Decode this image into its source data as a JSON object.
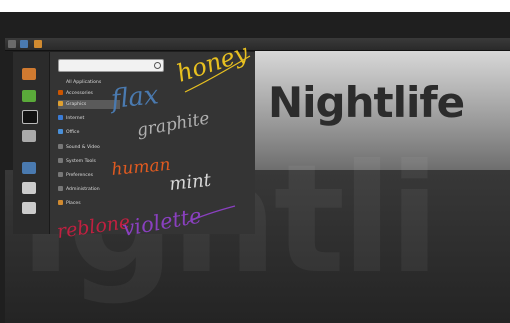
{
  "wallpaper": {
    "heading": "Nightlife",
    "big_text": "ightli"
  },
  "menu": {
    "search_placeholder": "",
    "categories": [
      {
        "label": "All Applications",
        "icon": "all-apps-icon",
        "color": "#888888"
      },
      {
        "label": "Accessories",
        "icon": "accessories-icon",
        "color": "#cc5500"
      },
      {
        "label": "Graphics",
        "icon": "graphics-icon",
        "color": "#e0a030"
      },
      {
        "label": "Internet",
        "icon": "internet-icon",
        "color": "#3a7bd5"
      },
      {
        "label": "Office",
        "icon": "office-icon",
        "color": "#4a90d9"
      },
      {
        "label": "Sound & Video",
        "icon": "sound-video-icon",
        "color": "#777777"
      },
      {
        "label": "System Tools",
        "icon": "system-tools-icon",
        "color": "#777777"
      },
      {
        "label": "Preferences",
        "icon": "preferences-icon",
        "color": "#777777"
      },
      {
        "label": "Administration",
        "icon": "administration-icon",
        "color": "#777777"
      },
      {
        "label": "Places",
        "icon": "places-icon",
        "color": "#d08a30"
      }
    ]
  },
  "annotations": {
    "honey": "honey",
    "flax": "flax",
    "graphite": "graphite",
    "human": "human",
    "mint": "mint",
    "reblone": "reblone",
    "violette": "violette"
  },
  "colors": {
    "honey": "#e8c020",
    "flax": "#4a7ab0",
    "graphite": "#b0b0b0",
    "human": "#e05a20",
    "mint": "#d8d8d8",
    "reblone": "#c02040",
    "violette": "#8a40c0"
  }
}
